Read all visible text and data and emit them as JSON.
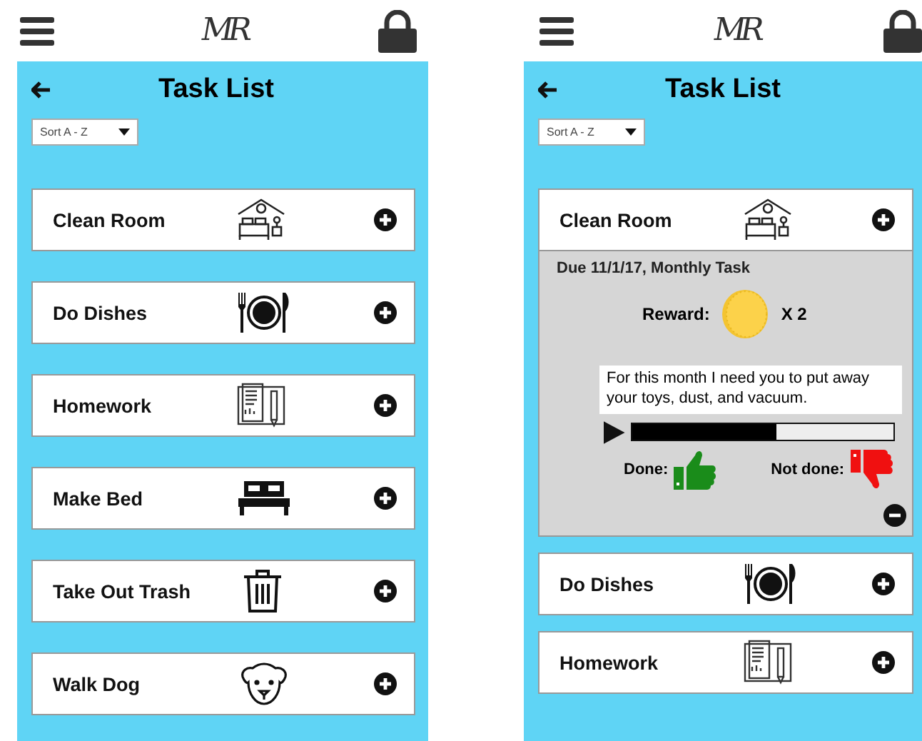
{
  "screens": [
    {
      "logo": "MR",
      "title": "Task List",
      "sort": "Sort A - Z",
      "tasks": [
        {
          "name": "Clean Room"
        },
        {
          "name": "Do Dishes"
        },
        {
          "name": "Homework"
        },
        {
          "name": "Make Bed"
        },
        {
          "name": "Take Out Trash"
        },
        {
          "name": "Walk Dog"
        }
      ]
    },
    {
      "logo": "MR",
      "title": "Task List",
      "sort": "Sort A - Z",
      "tasks": [
        {
          "name": "Clean Room",
          "expanded": true,
          "details": {
            "due": "Due 11/1/17, Monthly Task",
            "reward_label": "Reward:",
            "reward_count": "X 2",
            "message": "For this month I need you to put away your toys, dust, and vacuum.",
            "audio": {
              "level": 0.55
            },
            "done_label": "Done:",
            "not_done_label": "Not done:"
          }
        },
        {
          "name": "Do Dishes"
        },
        {
          "name": "Homework"
        }
      ]
    }
  ]
}
